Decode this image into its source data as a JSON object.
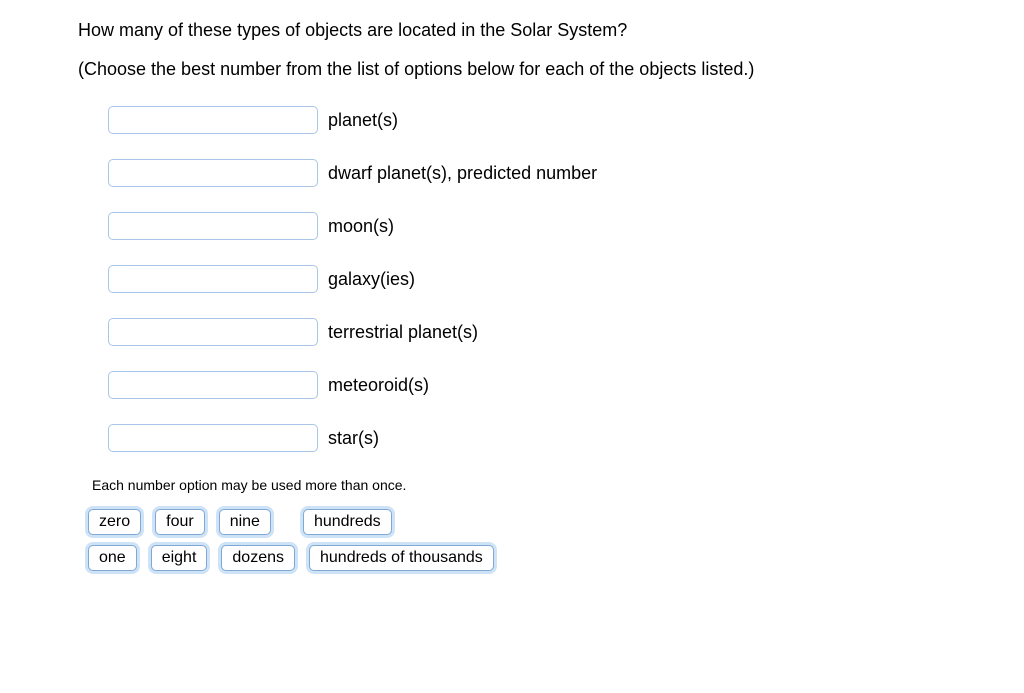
{
  "question": "How many of these types of objects are located in the Solar System?",
  "instruction": "(Choose the best number from the list of options below for each of the objects listed.)",
  "items": [
    {
      "label": "planet(s)"
    },
    {
      "label": "dwarf planet(s), predicted number"
    },
    {
      "label": "moon(s)"
    },
    {
      "label": "galaxy(ies)"
    },
    {
      "label": "terrestrial planet(s)"
    },
    {
      "label": "meteoroid(s)"
    },
    {
      "label": "star(s)"
    }
  ],
  "note": "Each number option may be used more than once.",
  "tokens_row1": [
    "zero",
    "four",
    "nine",
    "hundreds"
  ],
  "tokens_row2": [
    "one",
    "eight",
    "dozens",
    "hundreds of thousands"
  ]
}
